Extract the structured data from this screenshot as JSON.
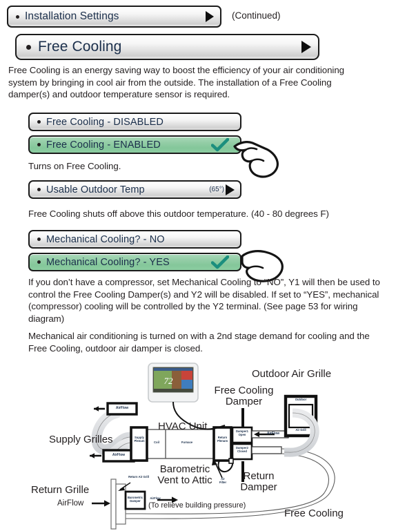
{
  "header": {
    "installation_settings_label": "Installation Settings",
    "continued_label": "(Continued)",
    "free_cooling_label": "Free Cooling"
  },
  "intro_paragraph": "Free Cooling is an energy saving way to boost the efficiency of your air conditioning system by bringing in cool air from the outside. The installation of a Free Cooling damper(s) and outdoor temperature sensor is required.",
  "options": {
    "free_cooling_disabled": "Free Cooling - DISABLED",
    "free_cooling_enabled": "Free Cooling - ENABLED",
    "free_cooling_note": "Turns on Free Cooling.",
    "usable_outdoor_temp": "Usable Outdoor Temp",
    "usable_outdoor_temp_value": "(65°)",
    "usable_outdoor_temp_note": "Free Cooling shuts off above this outdoor temperature. (40 - 80 degrees F)",
    "mechanical_cooling_no": "Mechanical Cooling? - NO",
    "mechanical_cooling_yes": "Mechanical Cooling? - YES"
  },
  "body_paragraph_1": "If you don’t have a compressor, set Mechanical Cooling to “NO”, Y1 will then be used to control the Free Cooling Damper(s) and Y2 will be disabled. If set to “YES”, mechanical (compressor) cooling will be controlled by the Y2 terminal. (See page 53 for wiring diagram)",
  "body_paragraph_2": "Mechanical air conditioning is turned on with a 2nd stage demand for cooling and the Free Cooling, outdoor air damper is closed.",
  "diagram": {
    "outdoor_air_grille": "Outdoor Air Grille",
    "free_cooling_damper": "Free Cooling\nDamper",
    "hvac_unit": "HVAC Unit",
    "supply_grilles": "Supply Grilles",
    "return_grille": "Return Grille",
    "return_damper": "Return\nDamper",
    "barometric_vent": "Barometric\nVent to Attic",
    "relieve_note": "(To relieve building pressure)",
    "free_cooling": "Free Cooling",
    "airflow_label": "AirFlow",
    "thermostat_temp": "72",
    "parts": {
      "supply_plenum": "Supply\nPlenum",
      "coil": "Coil",
      "furnace": "Furnace",
      "return_plenum": "Return\nPlenum",
      "damper1": "Damper1\nOpen",
      "damper2": "Damper2\nClosed",
      "air_filter": "Air\nFilter",
      "outdoor": "Outdoor",
      "air_grill": "Air Grill",
      "return_air_grill": "Return Air Grill",
      "barometric_damper": "Barometric\nDamper",
      "airflow": "AirFlow"
    }
  },
  "colors": {
    "selected_green": "#8ccda1",
    "check_teal": "#1c8f7e",
    "text": "#231f20",
    "button_text": "#1b2f4b"
  }
}
